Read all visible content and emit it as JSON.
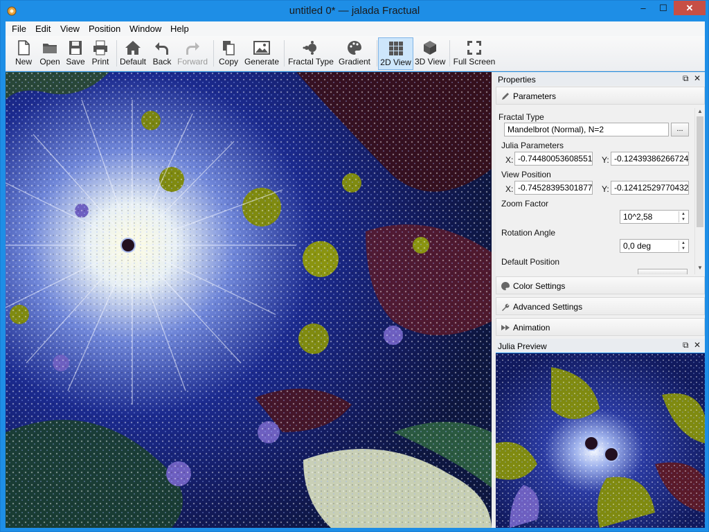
{
  "window": {
    "title": "untitled 0* — jalada Fractual",
    "minimize": "–",
    "maximize": "☐",
    "close": "✕"
  },
  "menu": [
    "File",
    "Edit",
    "View",
    "Position",
    "Window",
    "Help"
  ],
  "toolbar": {
    "new": "New",
    "open": "Open",
    "save": "Save",
    "print": "Print",
    "default": "Default",
    "back": "Back",
    "forward": "Forward",
    "copy": "Copy",
    "generate": "Generate",
    "fractal_type": "Fractal Type",
    "gradient": "Gradient",
    "view2d": "2D View",
    "view3d": "3D View",
    "fullscreen": "Full Screen"
  },
  "properties": {
    "title": "Properties",
    "parameters_header": "Parameters",
    "fractal_type_label": "Fractal Type",
    "fractal_type_value": "Mandelbrot (Normal), N=2",
    "browse": "...",
    "julia_label": "Julia Parameters",
    "julia_x_label": "X:",
    "julia_x": "-0.74480053608551",
    "julia_y_label": "Y:",
    "julia_y": "-0.12439386266724",
    "view_label": "View Position",
    "view_x_label": "X:",
    "view_x": "-0.74528395301877",
    "view_y_label": "Y:",
    "view_y": "-0.12412529770432",
    "zoom_label": "Zoom Factor",
    "zoom_value": "10^2,58",
    "rotation_label": "Rotation Angle",
    "rotation_value": "0,0 deg",
    "default_position_label": "Default Position",
    "color_settings": "Color Settings",
    "advanced_settings": "Advanced Settings",
    "animation": "Animation"
  },
  "julia_preview": {
    "title": "Julia Preview"
  },
  "icons": {
    "new": "new-document-icon",
    "open": "folder-icon",
    "save": "floppy-icon",
    "print": "printer-icon",
    "default": "home-icon",
    "back": "arrow-back-icon",
    "forward": "arrow-forward-icon",
    "copy": "copy-icon",
    "generate": "image-icon",
    "fractal_type": "fractal-icon",
    "gradient": "palette-icon",
    "view2d": "grid-icon",
    "view3d": "cube-icon",
    "fullscreen": "fullscreen-icon"
  },
  "colors": {
    "titlebar": "#1e8ee6",
    "close": "#c74f45",
    "active_tool": "#cde6fb",
    "fractal_deep": "#101a70",
    "fractal_olive": "#7f8a10",
    "fractal_maroon": "#5a1a2a"
  }
}
